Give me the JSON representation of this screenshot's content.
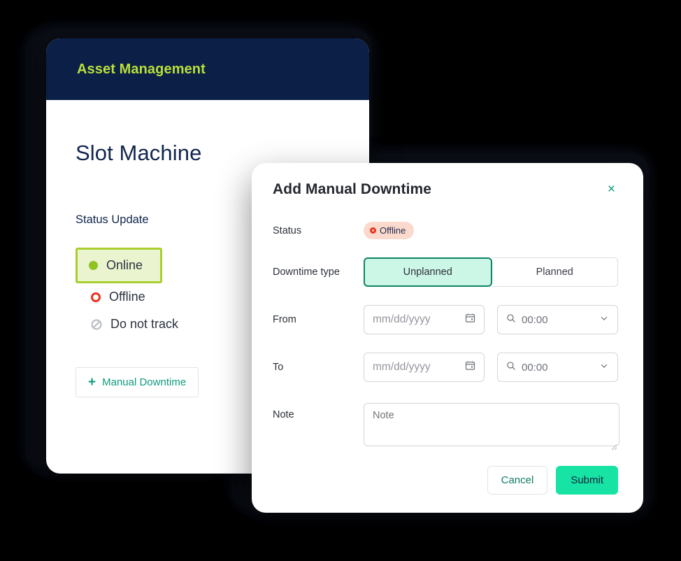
{
  "app": {
    "header_title": "Asset Management",
    "page_title": "Slot Machine",
    "section_label": "Status Update",
    "status_options": [
      {
        "label": "Online",
        "icon": "filled-circle-icon",
        "selected": true
      },
      {
        "label": "Offline",
        "icon": "ring-circle-icon",
        "selected": false
      },
      {
        "label": "Do not track",
        "icon": "no-entry-icon",
        "selected": false
      }
    ],
    "manual_downtime_button": "Manual Downtime",
    "manual_downtime_plus": "+"
  },
  "dialog": {
    "title": "Add Manual Downtime",
    "close_label": "×",
    "rows": {
      "status_label": "Status",
      "status_badge": "Offline",
      "downtime_type_label": "Downtime type",
      "segment_unplanned": "Unplanned",
      "segment_planned": "Planned",
      "from_label": "From",
      "to_label": "To",
      "note_label": "Note"
    },
    "fields": {
      "date_placeholder": "mm/dd/yyyy",
      "time_value": "00:00",
      "note_placeholder": "Note"
    },
    "buttons": {
      "cancel": "Cancel",
      "submit": "Submit"
    }
  },
  "colors": {
    "background": "#000000",
    "header_navy": "#0c2047",
    "accent_lime": "#b9e03a",
    "accent_teal": "#0f9b7e",
    "accent_green": "#16e3a4",
    "status_online": "#8fc322",
    "status_offline": "#e8341c",
    "badge_bg": "#fcd9cd",
    "segment_active_bg": "#ccf6e6",
    "segment_active_border": "#0d8466",
    "selected_option_bg": "#eaf4cf",
    "selected_option_border": "#a9ce2e"
  }
}
